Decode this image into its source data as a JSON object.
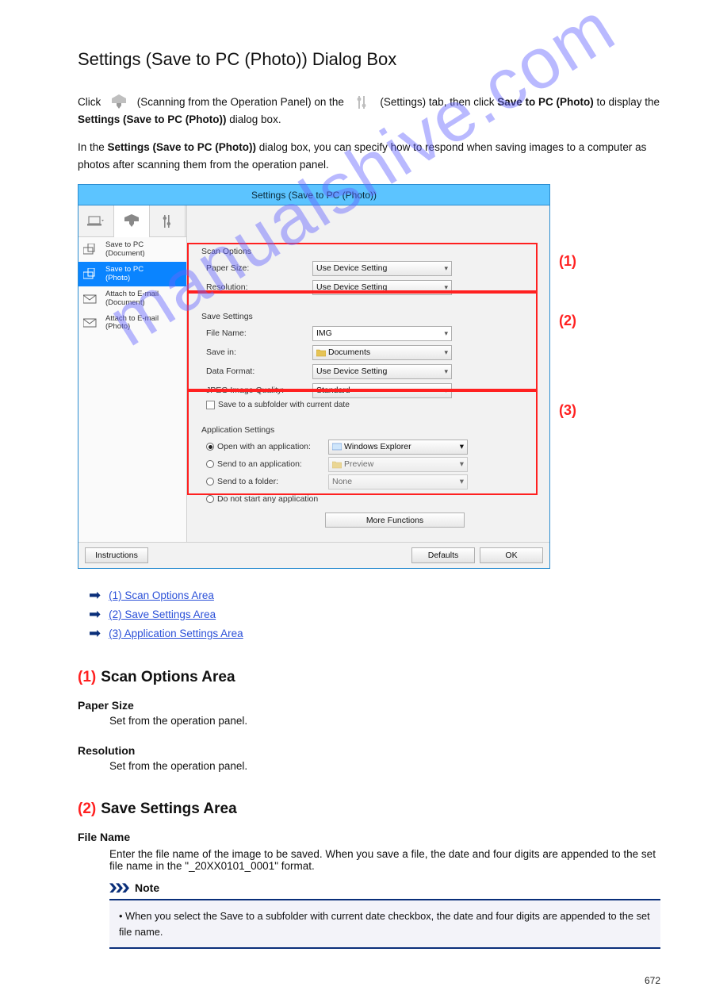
{
  "heading": "Settings (Save to PC (Photo)) Dialog Box",
  "intro_a": "Click ",
  "intro_b": " (Scanning from the Operation Panel) on the ",
  "intro_c": " (Settings) tab, then click ",
  "intro_d": "Save to PC (Photo)",
  "intro_e": " to display the ",
  "intro_f": "Settings (Save to PC (Photo))",
  "intro_g": " dialog box.",
  "intro2_a": "In the ",
  "intro2_b": "Settings (Save to PC (Photo))",
  "intro2_c": " dialog box, you can specify how to respond when saving images to a computer as photos after scanning them from the operation panel.",
  "dialog": {
    "title": "Settings (Save to PC (Photo))",
    "sidebar": [
      {
        "line1": "Save to PC",
        "line2": "(Document)"
      },
      {
        "line1": "Save to PC",
        "line2": "(Photo)"
      },
      {
        "line1": "Attach to E-mail",
        "line2": "(Document)"
      },
      {
        "line1": "Attach to E-mail",
        "line2": "(Photo)"
      }
    ],
    "p1": {
      "title": "Scan Options",
      "paperSizeLabel": "Paper Size:",
      "paperSizeValue": "Use Device Setting",
      "resolutionLabel": "Resolution:",
      "resolutionValue": "Use Device Setting",
      "markLabel": "(1)"
    },
    "p2": {
      "title": "Save Settings",
      "fileNameLabel": "File Name:",
      "fileNameValue": "IMG",
      "saveInLabel": "Save in:",
      "saveInValue": "Documents",
      "dataFormatLabel": "Data Format:",
      "dataFormatValue": "Use Device Setting",
      "jpegQLabel": "JPEG Image Quality:",
      "jpegQValue": "Standard",
      "subfolderLabel": "Save to a subfolder with current date",
      "markLabel": "(2)"
    },
    "p3": {
      "title": "Application Settings",
      "openAppLabel": "Open with an application:",
      "openAppValue": "Windows Explorer",
      "sendAppLabel": "Send to an application:",
      "sendAppValue": "Preview",
      "sendFolderLabel": "Send to a folder:",
      "sendFolderValue": "None",
      "doNotStartLabel": "Do not start any application",
      "moreFnLabel": "More Functions",
      "markLabel": "(3)"
    },
    "footer": {
      "instructions": "Instructions",
      "defaults": "Defaults",
      "ok": "OK"
    }
  },
  "links": [
    "(1) Scan Options Area",
    "(2) Save Settings Area",
    "(3) Application Settings Area"
  ],
  "section": {
    "lead": "(1)",
    "title": "Scan Options Area",
    "terms": {
      "paperSize": "Paper Size",
      "paperSizeDesc": "Set from the operation panel.",
      "resolution": "Resolution",
      "resolutionDesc": "Set from the operation panel."
    }
  },
  "section2": {
    "lead": "(2)",
    "title": "Save Settings Area",
    "fileNameTerm": "File Name",
    "fileNameDesc": "Enter the file name of the image to be saved. When you save a file, the date and four digits are appended to the set file name in the \"_20XX0101_0001\" format.",
    "noteLabel": "Note",
    "noteBullet": "When you select the Save to a subfolder with current date checkbox, the date and four digits are appended to the set file name."
  },
  "watermark": "manualshive.com",
  "pageNumber": "672"
}
